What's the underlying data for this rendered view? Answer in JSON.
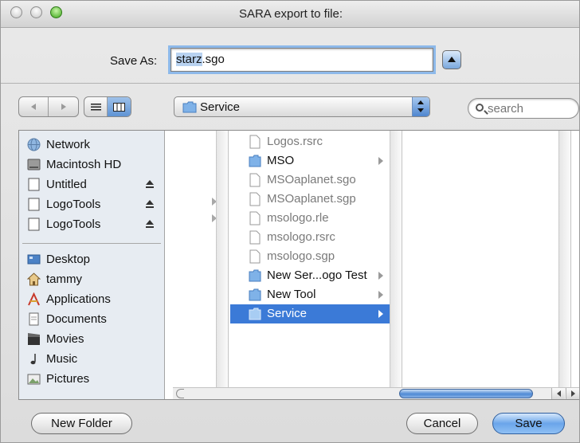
{
  "window": {
    "title": "SARA export to file:"
  },
  "save_as": {
    "label": "Save As:",
    "filename_selected": "starz",
    "filename_ext": ".sgo"
  },
  "location_popup": {
    "label": "Service"
  },
  "search": {
    "placeholder": "search"
  },
  "sidebar": {
    "devices": [
      {
        "label": "Network",
        "icon": "network-globe-icon",
        "eject": false
      },
      {
        "label": "Macintosh HD",
        "icon": "hard-drive-icon",
        "eject": false
      },
      {
        "label": "Untitled",
        "icon": "volume-icon",
        "eject": true
      },
      {
        "label": "LogoTools",
        "icon": "volume-icon",
        "eject": true
      },
      {
        "label": "LogoTools",
        "icon": "volume-icon",
        "eject": true
      }
    ],
    "places": [
      {
        "label": "Desktop",
        "icon": "desktop-icon"
      },
      {
        "label": "tammy",
        "icon": "home-icon"
      },
      {
        "label": "Applications",
        "icon": "applications-icon"
      },
      {
        "label": "Documents",
        "icon": "documents-icon"
      },
      {
        "label": "Movies",
        "icon": "movies-icon"
      },
      {
        "label": "Music",
        "icon": "music-icon"
      },
      {
        "label": "Pictures",
        "icon": "pictures-icon"
      }
    ]
  },
  "files": [
    {
      "name": "Logos.rsrc",
      "type": "file",
      "dimmed": true
    },
    {
      "name": "MSO",
      "type": "folder",
      "dimmed": false
    },
    {
      "name": "MSOaplanet.sgo",
      "type": "file",
      "dimmed": true
    },
    {
      "name": "MSOaplanet.sgp",
      "type": "file",
      "dimmed": true
    },
    {
      "name": "msologo.rle",
      "type": "file",
      "dimmed": true
    },
    {
      "name": "msologo.rsrc",
      "type": "file",
      "dimmed": true
    },
    {
      "name": "msologo.sgp",
      "type": "file",
      "dimmed": true
    },
    {
      "name": "New Ser...ogo Test",
      "type": "folder",
      "dimmed": false
    },
    {
      "name": "New Tool",
      "type": "folder",
      "dimmed": false
    },
    {
      "name": "Service",
      "type": "folder",
      "dimmed": false,
      "selected": true
    }
  ],
  "buttons": {
    "new_folder": "New Folder",
    "cancel": "Cancel",
    "save": "Save"
  },
  "colors": {
    "selection": "#3b7ad7",
    "sidebar_bg": "#e7ecf2",
    "default_button": "#6aa5ea"
  }
}
